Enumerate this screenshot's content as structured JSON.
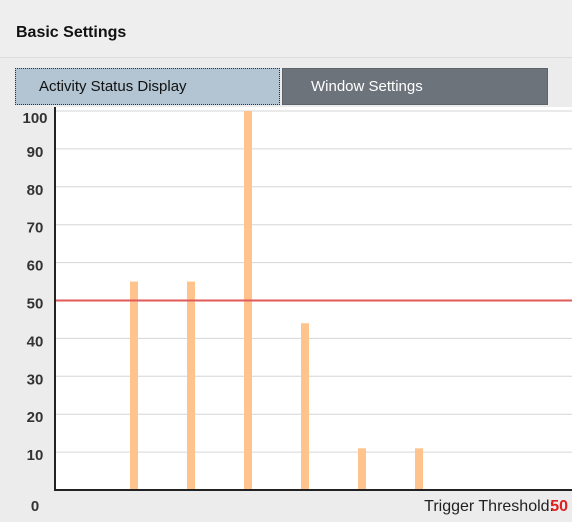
{
  "header": {
    "title": "Basic Settings"
  },
  "tabs": [
    {
      "label": "Activity Status Display",
      "active": true
    },
    {
      "label": "Window Settings",
      "active": false
    }
  ],
  "colors": {
    "bar": "#ffc48e",
    "threshold_line": "#e05a5a",
    "threshold_value": "#e02020",
    "tab_active": "#b3c4d2",
    "tab_inactive": "#6c737b"
  },
  "chart_data": {
    "type": "bar",
    "ylim": [
      0,
      100
    ],
    "yticks": [
      0,
      10,
      20,
      30,
      40,
      50,
      60,
      70,
      80,
      90,
      100
    ],
    "values": [
      55,
      55,
      100,
      44,
      11,
      11
    ],
    "grid": true,
    "threshold": 50
  },
  "footer": {
    "threshold_label": "Trigger Threshold:",
    "threshold_value": "50"
  }
}
